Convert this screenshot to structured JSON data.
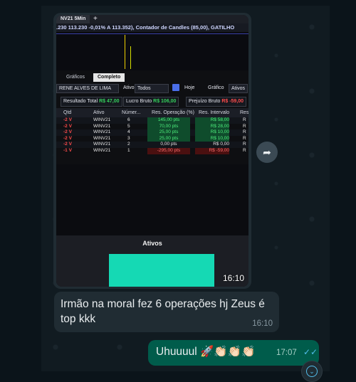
{
  "image_message": {
    "time": "16:10",
    "screen": {
      "tab_title": "NV21 5Min",
      "tab_add": "+",
      "ticker": ".230 113.230 -0,01% A 113.352), Contador de Candles (85,00), GATILHO",
      "subtabs": [
        "Gráficos",
        "Completo"
      ],
      "filters": {
        "account": "RENE ALVES DE LIMA",
        "asset_label": "Ativo",
        "asset_value": "Todos",
        "period": "Hoje",
        "chart_label": "Gráfico",
        "assets_btn": "Ativos"
      },
      "summary": {
        "result_label": "Resultado Total",
        "result_value": "R$ 47,00",
        "gross_label": "Lucro Bruto",
        "gross_value": "R$ 106,00",
        "loss_label": "Prejuízo Bruto",
        "loss_value": "R$ -59,00"
      },
      "table": {
        "headers": [
          "Qtd",
          "Ativo",
          "Númer...",
          "Res. Operação (%)",
          "Res. Intervalo",
          "Res"
        ],
        "rows": [
          {
            "qtd": "-2 V",
            "ativo": "WINV21",
            "num": "6",
            "res": "145,00 pts",
            "res_sign": "pos",
            "int": "R$ 58,00",
            "int_sign": "pos",
            "last": "R"
          },
          {
            "qtd": "-2 V",
            "ativo": "WINV21",
            "num": "5",
            "res": "70,00 pts",
            "res_sign": "pos",
            "int": "R$ 28,00",
            "int_sign": "pos",
            "last": "R"
          },
          {
            "qtd": "-2 V",
            "ativo": "WINV21",
            "num": "4",
            "res": "25,00 pts",
            "res_sign": "pos",
            "int": "R$ 10,00",
            "int_sign": "pos",
            "last": "R"
          },
          {
            "qtd": "-2 V",
            "ativo": "WINV21",
            "num": "3",
            "res": "25,00 pts",
            "res_sign": "pos",
            "int": "R$ 10,00",
            "int_sign": "pos",
            "last": "R"
          },
          {
            "qtd": "-2 V",
            "ativo": "WINV21",
            "num": "2",
            "res": "0,00 pts",
            "res_sign": "none",
            "int": "R$ 0,00",
            "int_sign": "none",
            "last": "R"
          },
          {
            "qtd": "-1 V",
            "ativo": "WINV21",
            "num": "1",
            "res": "-295,00 pts",
            "res_sign": "neg",
            "int": "R$ -59,00",
            "int_sign": "neg",
            "last": "R"
          }
        ]
      },
      "panel_title": "Ativos"
    }
  },
  "text_message": {
    "text": "Irmão na moral fez 6 operações hj Zeus é top kkk",
    "time": "16:10"
  },
  "outgoing_message": {
    "text": "Uhuuuul 🚀👏🏻👏🏻👏🏻",
    "time": "17:07",
    "ticks": "✓✓"
  },
  "icons": {
    "forward": "forward-arrow-icon",
    "scroll_down": "chevron-down-icon"
  }
}
